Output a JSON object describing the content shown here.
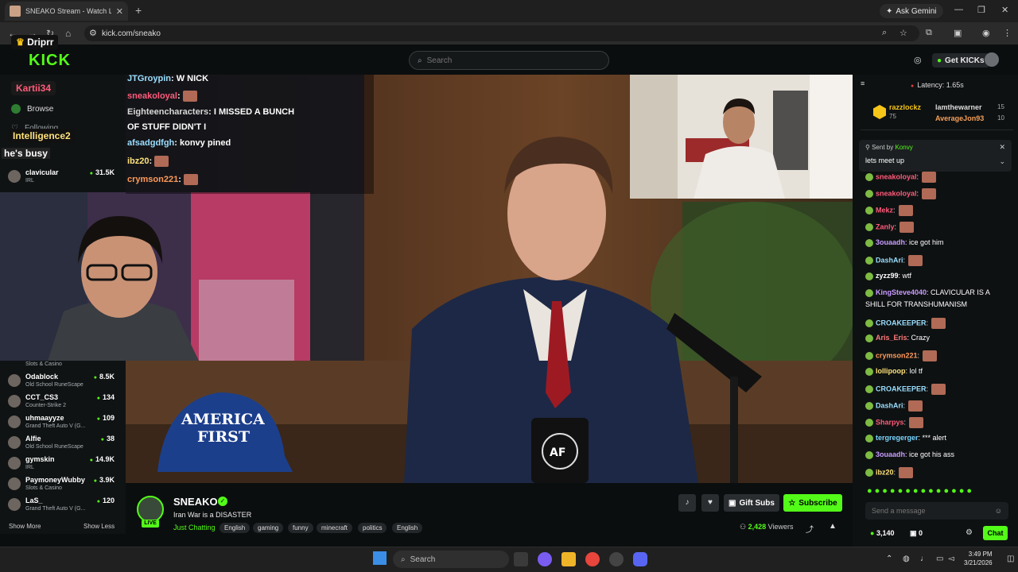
{
  "browser": {
    "tab_title": "SNEAKO Stream - Watch L",
    "new_tab_icon": "plus-icon",
    "ask_gemini": "Ask Gemini",
    "url": "kick.com/sneako"
  },
  "kick": {
    "logo": "KICK",
    "search_placeholder": "Search",
    "get_kicks": "Get KICKs"
  },
  "sidebar": {
    "browse": "Browse",
    "following": "Following",
    "channels_top": [
      {
        "name": "clavicular",
        "category": "IRL",
        "viewers": "31.5K"
      }
    ],
    "channels": [
      {
        "name": "Odablock",
        "category": "Old School RuneScape",
        "viewers": "8.5K"
      },
      {
        "name": "CCT_CS3",
        "category": "Counter-Strike 2",
        "viewers": "134"
      },
      {
        "name": "uhmaayyze",
        "category": "Grand Theft Auto V (G...",
        "viewers": "109"
      },
      {
        "name": "Alfie",
        "category": "Old School RuneScape",
        "viewers": "38"
      },
      {
        "name": "gymskin",
        "category": "IRL",
        "viewers": "14.9K"
      },
      {
        "name": "PaymoneyWubby",
        "category": "Slots & Casino",
        "viewers": "3.9K"
      },
      {
        "name": "LaS_",
        "category": "Grand Theft Auto V (G...",
        "viewers": "120"
      }
    ],
    "slots_label": "Slots & Casino",
    "show_more": "Show More",
    "show_less": "Show Less"
  },
  "overlay": {
    "dripr": "Driprr",
    "kartii": "Kartii34",
    "intelligence": "Intelligence2",
    "hes_busy": "he's busy",
    "lines": [
      {
        "user": "JTGroypin",
        "text": ": W NICK"
      },
      {
        "user": "sneakoloyal",
        "text": ":"
      },
      {
        "user": "Eighteencharacters",
        "text": ": I MISSED A BUNCH"
      },
      {
        "user": "",
        "text": "OF STUFF DIDN'T I"
      },
      {
        "user": "afsadgdfgh",
        "text": ": konvy pined"
      },
      {
        "user": "ibz20",
        "text": ":"
      },
      {
        "user": "crymson221",
        "text": ":"
      }
    ]
  },
  "stream": {
    "streamer": "SNEAKO",
    "live": "LIVE",
    "title": "Iran War is a DISASTER",
    "category": "Just Chatting",
    "tags": [
      "English",
      "gaming",
      "funny",
      "minecraft",
      "politics",
      "English"
    ],
    "gift_subs": "Gift Subs",
    "subscribe": "Subscribe",
    "viewers_count": "2,428",
    "viewers_label": "Viewers",
    "hat_text_1": "AMERICA",
    "hat_text_2": "FIRST",
    "mug_text": "AF"
  },
  "chat": {
    "latency": "Latency: 1.65s",
    "gifters": [
      {
        "name": "razzlockz",
        "count": "75"
      },
      {
        "name": "lamthewarner",
        "count": "15"
      },
      {
        "name": "AverageJon93",
        "count": "10"
      }
    ],
    "pinned_by_label": "Sent by",
    "pinned_by": "Konvy",
    "pinned_text": "lets meet up",
    "messages": [
      {
        "user": "sneakoloyal",
        "text": ":",
        "color": "#ff5b7a"
      },
      {
        "user": "sneakoloyal",
        "text": ":",
        "color": "#ff5b7a"
      },
      {
        "user": "Mekz",
        "text": ":",
        "color": "#ff5b7a"
      },
      {
        "user": "Zanly",
        "text": ":",
        "color": "#ff5b7a"
      },
      {
        "user": "3ouaadh",
        "text": ": ice got him",
        "color": "#c99cff"
      },
      {
        "user": "DashAri",
        "text": ":",
        "color": "#9adfff"
      },
      {
        "user": "zyzz99",
        "text": ": wtf",
        "color": "#ffffff"
      },
      {
        "user": "KingSteve4040",
        "text": ": CLAVICULAR IS A",
        "color": "#c99cff"
      },
      {
        "user": "",
        "text": "SHILL FOR TRANSHUMANISM",
        "color": "#ffffff"
      },
      {
        "user": "CROAKEEPER",
        "text": ":",
        "color": "#9adfff"
      },
      {
        "user": "Aris_Eris",
        "text": ": Crazy",
        "color": "#ff7a7a"
      },
      {
        "user": "crymson221",
        "text": ":",
        "color": "#ff9a5a"
      },
      {
        "user": "lollipoop",
        "text": ": lol tf",
        "color": "#ffe27a"
      },
      {
        "user": "CROAKEEPER",
        "text": ":",
        "color": "#9adfff"
      },
      {
        "user": "DashAri",
        "text": ":",
        "color": "#9adfff"
      },
      {
        "user": "Sharpys",
        "text": ":",
        "color": "#ff5b7a"
      },
      {
        "user": "tergregerger",
        "text": ": *** alert",
        "color": "#7ad6ff"
      },
      {
        "user": "3ouaadh",
        "text": ": ice got his ass",
        "color": "#c99cff"
      },
      {
        "user": "ibz20",
        "text": ":",
        "color": "#ffe27a"
      }
    ],
    "input_placeholder": "Send a message",
    "kicks_count": "3,140",
    "second_count": "0",
    "chat_button": "Chat"
  },
  "taskbar": {
    "search_placeholder": "Search",
    "time": "3:49 PM",
    "date": "3/21/2026"
  },
  "colors": {
    "accent": "#53fc18",
    "background": "#0b0e0f"
  }
}
